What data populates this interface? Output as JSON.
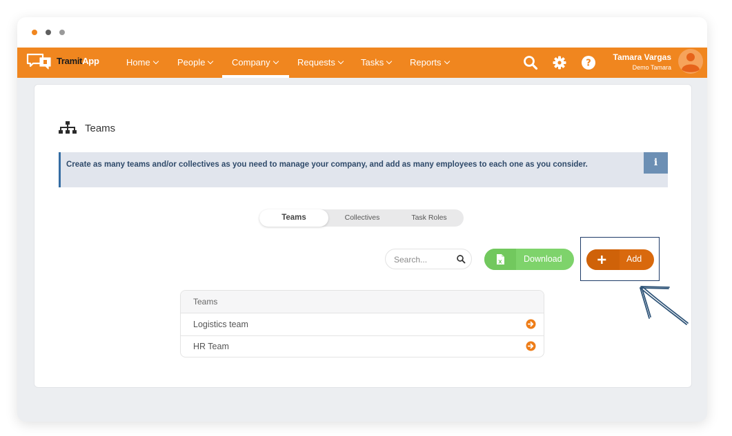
{
  "app": {
    "brand": {
      "part1": "Tramit",
      "part2": "App"
    },
    "accent_color": "#f0861f"
  },
  "nav": {
    "items": [
      {
        "label": "Home",
        "active": false
      },
      {
        "label": "People",
        "active": false
      },
      {
        "label": "Company",
        "active": true
      },
      {
        "label": "Requests",
        "active": false
      },
      {
        "label": "Tasks",
        "active": false
      },
      {
        "label": "Reports",
        "active": false
      }
    ],
    "icons": [
      "search-icon",
      "gear-icon",
      "help-icon"
    ]
  },
  "user": {
    "name": "Tamara Vargas",
    "company": "Demo Tamara"
  },
  "page": {
    "title": "Teams",
    "icon": "org-chart-icon",
    "info_text": "Create as many teams and/or collectives as you need to manage your company, and add as many employees to each one as you consider.",
    "info_icon_glyph": "i"
  },
  "tabs": [
    {
      "label": "Teams",
      "active": true
    },
    {
      "label": "Collectives",
      "active": false
    },
    {
      "label": "Task Roles",
      "active": false
    }
  ],
  "toolbar": {
    "search_placeholder": "Search...",
    "download_label": "Download",
    "add_label": "Add",
    "download_color": "#7ed36b",
    "add_color": "#d9690d"
  },
  "table": {
    "header": "Teams",
    "rows": [
      {
        "name": "Logistics team"
      },
      {
        "name": "HR Team"
      }
    ]
  }
}
